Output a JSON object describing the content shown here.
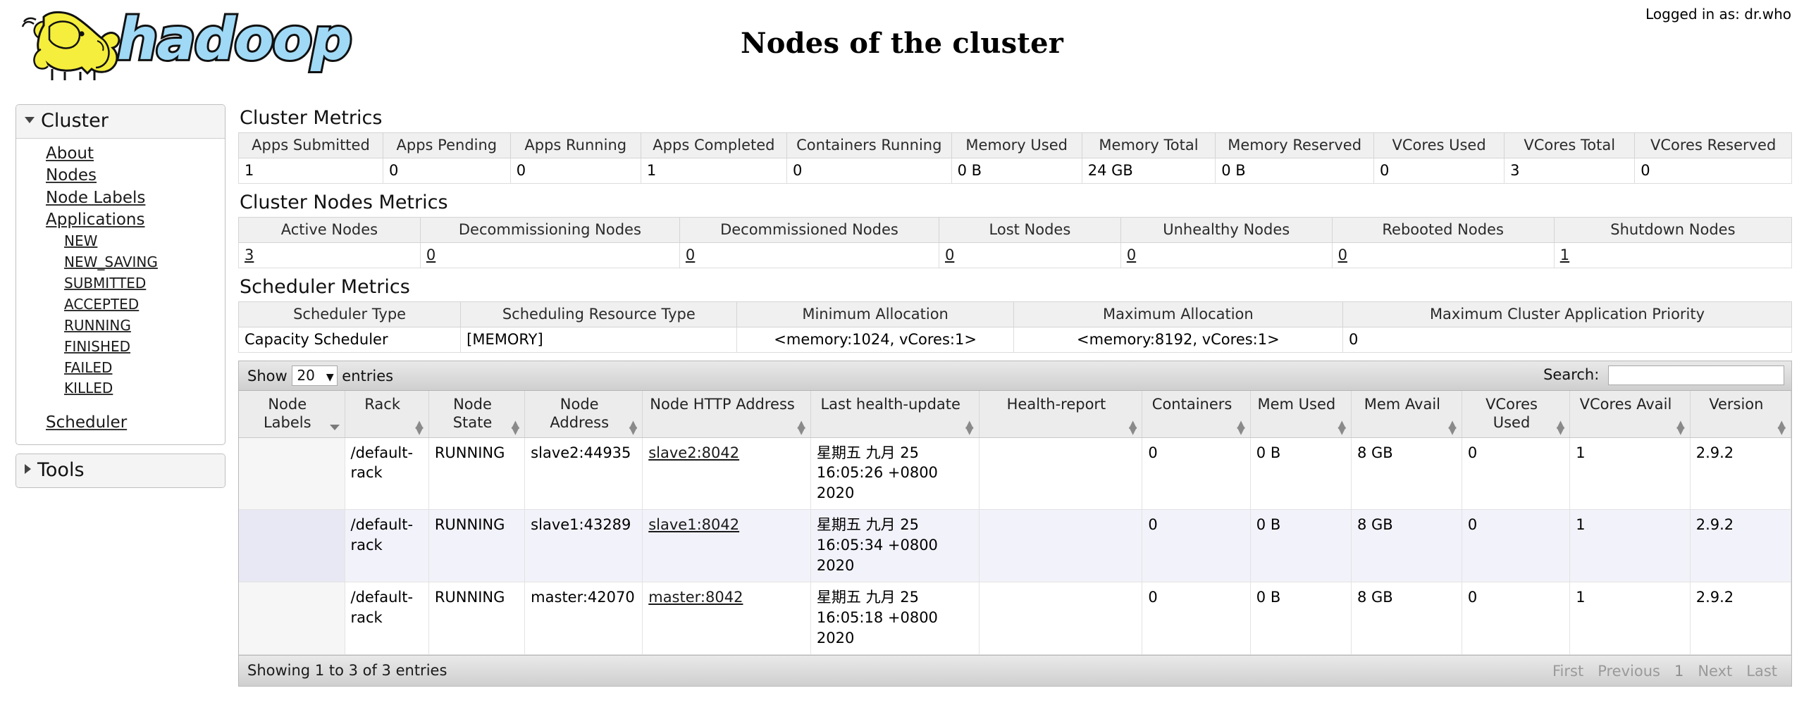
{
  "header": {
    "title": "Nodes of the cluster",
    "user_info": "Logged in as: dr.who",
    "logo_alt": "hadoop"
  },
  "sidebar": {
    "cluster": {
      "label": "Cluster",
      "expanded_icon": "triangle-down-icon",
      "links": [
        {
          "label": "About"
        },
        {
          "label": "Nodes"
        },
        {
          "label": "Node Labels"
        },
        {
          "label": "Applications"
        }
      ],
      "app_states": [
        {
          "label": "NEW"
        },
        {
          "label": "NEW_SAVING"
        },
        {
          "label": "SUBMITTED"
        },
        {
          "label": "ACCEPTED"
        },
        {
          "label": "RUNNING"
        },
        {
          "label": "FINISHED"
        },
        {
          "label": "FAILED"
        },
        {
          "label": "KILLED"
        }
      ],
      "scheduler": {
        "label": "Scheduler"
      }
    },
    "tools": {
      "label": "Tools",
      "collapsed_icon": "triangle-right-icon"
    }
  },
  "cluster_metrics": {
    "title": "Cluster Metrics",
    "headers": [
      "Apps Submitted",
      "Apps Pending",
      "Apps Running",
      "Apps Completed",
      "Containers Running",
      "Memory Used",
      "Memory Total",
      "Memory Reserved",
      "VCores Used",
      "VCores Total",
      "VCores Reserved"
    ],
    "values": [
      "1",
      "0",
      "0",
      "1",
      "0",
      "0 B",
      "24 GB",
      "0 B",
      "0",
      "3",
      "0"
    ]
  },
  "cluster_nodes_metrics": {
    "title": "Cluster Nodes Metrics",
    "headers": [
      "Active Nodes",
      "Decommissioning Nodes",
      "Decommissioned Nodes",
      "Lost Nodes",
      "Unhealthy Nodes",
      "Rebooted Nodes",
      "Shutdown Nodes"
    ],
    "values": [
      "3",
      "0",
      "0",
      "0",
      "0",
      "0",
      "1"
    ]
  },
  "scheduler_metrics": {
    "title": "Scheduler Metrics",
    "headers": [
      "Scheduler Type",
      "Scheduling Resource Type",
      "Minimum Allocation",
      "Maximum Allocation",
      "Maximum Cluster Application Priority"
    ],
    "values": [
      "Capacity Scheduler",
      "[MEMORY]",
      "<memory:1024, vCores:1>",
      "<memory:8192, vCores:1>",
      "0"
    ]
  },
  "nodes_table": {
    "length_label_before": "Show",
    "length_value": "20",
    "length_label_after": "entries",
    "search_label": "Search:",
    "search_value": "",
    "search_placeholder": "",
    "columns": [
      {
        "label": "Node Labels",
        "sorted": true
      },
      {
        "label": "Rack",
        "sorted": false
      },
      {
        "label": "Node State",
        "sorted": false
      },
      {
        "label": "Node Address",
        "sorted": false
      },
      {
        "label": "Node HTTP Address",
        "sorted": false
      },
      {
        "label": "Last health-update",
        "sorted": false
      },
      {
        "label": "Health-report",
        "sorted": false
      },
      {
        "label": "Containers",
        "sorted": false
      },
      {
        "label": "Mem Used",
        "sorted": false
      },
      {
        "label": "Mem Avail",
        "sorted": false
      },
      {
        "label": "VCores Used",
        "sorted": false
      },
      {
        "label": "VCores Avail",
        "sorted": false
      },
      {
        "label": "Version",
        "sorted": false
      }
    ],
    "rows": [
      {
        "node_labels": "",
        "rack": "/default-rack",
        "node_state": "RUNNING",
        "node_address": "slave2:44935",
        "node_http_address": "slave2:8042",
        "last_health_update": "星期五 九月 25 16:05:26 +0800 2020",
        "health_report": "",
        "containers": "0",
        "mem_used": "0 B",
        "mem_avail": "8 GB",
        "vcores_used": "0",
        "vcores_avail": "1",
        "version": "2.9.2"
      },
      {
        "node_labels": "",
        "rack": "/default-rack",
        "node_state": "RUNNING",
        "node_address": "slave1:43289",
        "node_http_address": "slave1:8042",
        "last_health_update": "星期五 九月 25 16:05:34 +0800 2020",
        "health_report": "",
        "containers": "0",
        "mem_used": "0 B",
        "mem_avail": "8 GB",
        "vcores_used": "0",
        "vcores_avail": "1",
        "version": "2.9.2"
      },
      {
        "node_labels": "",
        "rack": "/default-rack",
        "node_state": "RUNNING",
        "node_address": "master:42070",
        "node_http_address": "master:8042",
        "last_health_update": "星期五 九月 25 16:05:18 +0800 2020",
        "health_report": "",
        "containers": "0",
        "mem_used": "0 B",
        "mem_avail": "8 GB",
        "vcores_used": "0",
        "vcores_avail": "1",
        "version": "2.9.2"
      }
    ],
    "footer_info": "Showing 1 to 3 of 3 entries",
    "pagination": [
      {
        "label": "First"
      },
      {
        "label": "Previous"
      },
      {
        "label": "1"
      },
      {
        "label": "Next"
      },
      {
        "label": "Last"
      }
    ]
  },
  "colors": {
    "logo_blue": "#9fd9f6",
    "logo_yellow": "#f5ee3c",
    "toolbar_gray": "#cfcfcf",
    "header_gray": "#ececec",
    "row_alt": "#f2f2fa"
  }
}
